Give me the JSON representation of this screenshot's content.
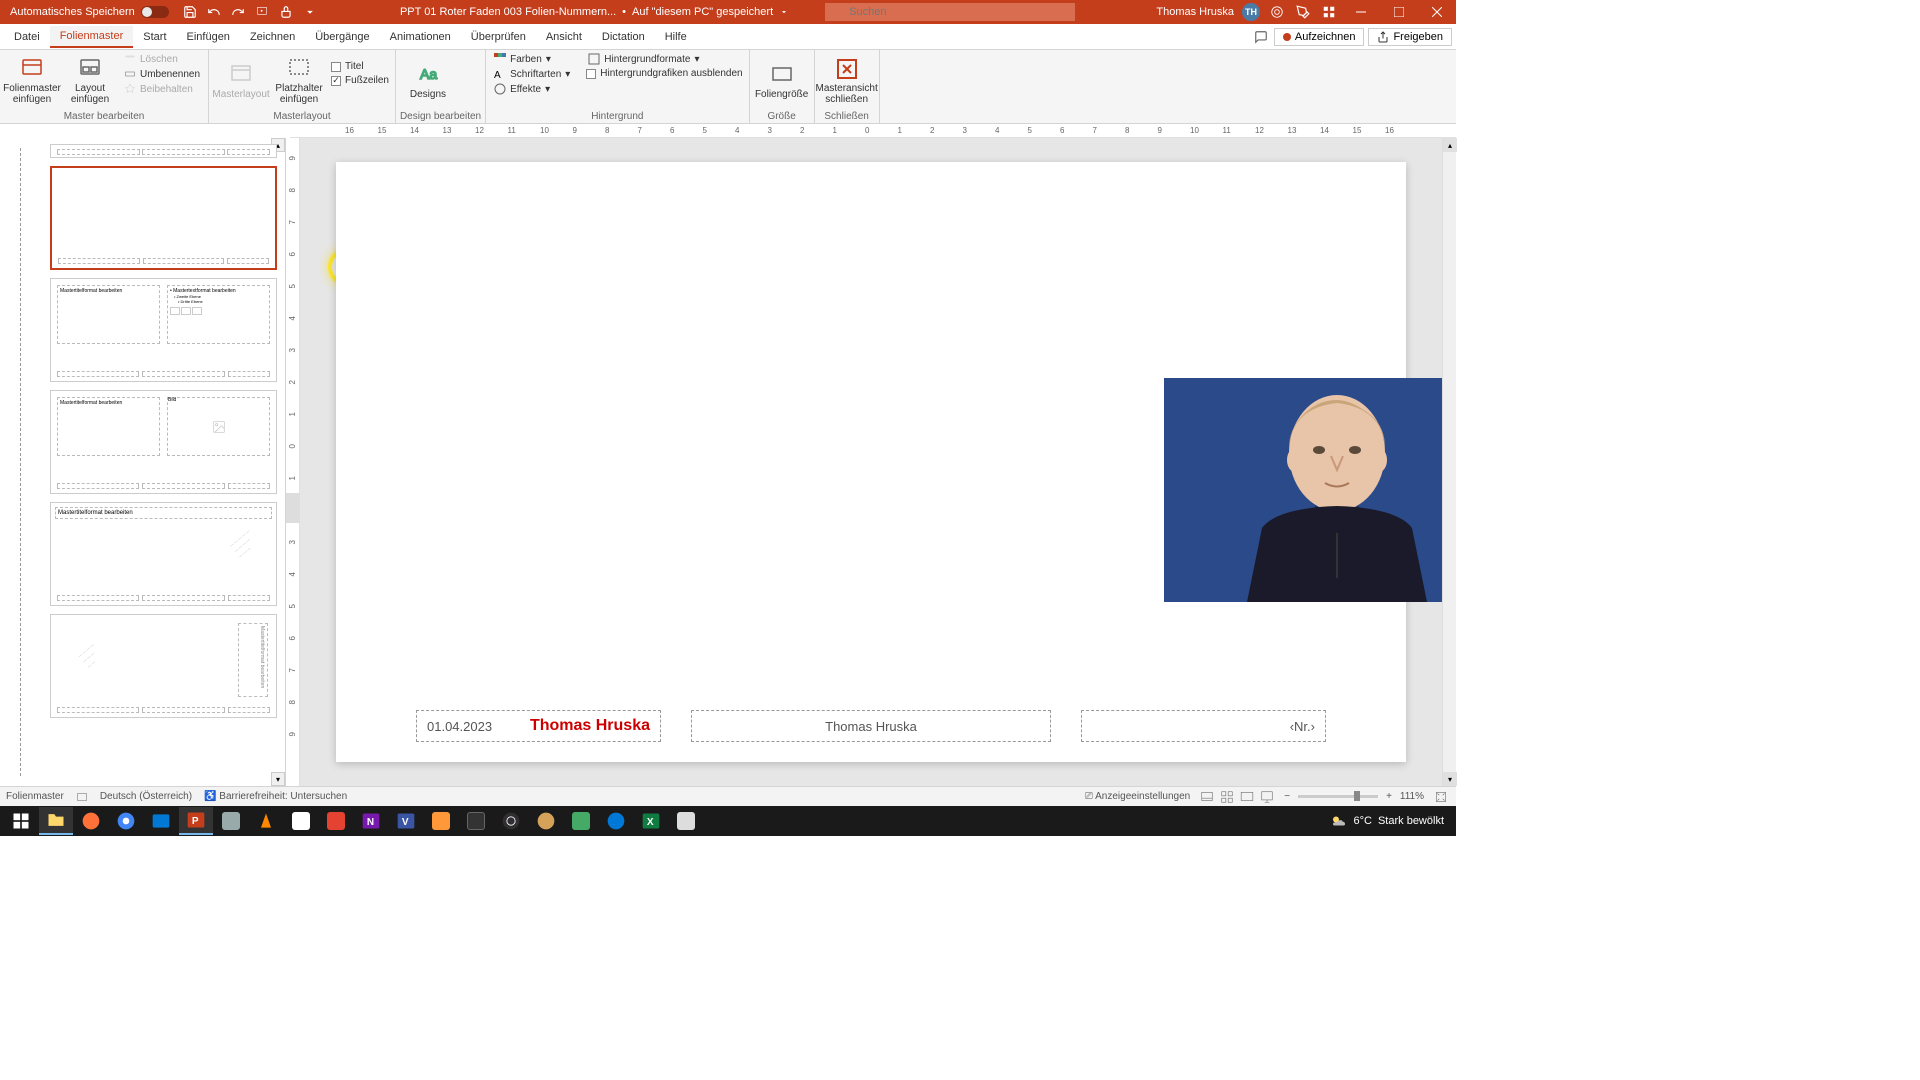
{
  "titlebar": {
    "autosave_label": "Automatisches Speichern",
    "filename": "PPT 01 Roter Faden 003 Folien-Nummern...",
    "save_status": "Auf \"diesem PC\" gespeichert",
    "search_placeholder": "Suchen",
    "user_name": "Thomas Hruska",
    "user_initials": "TH"
  },
  "menu": {
    "items": [
      "Datei",
      "Folienmaster",
      "Start",
      "Einfügen",
      "Zeichnen",
      "Übergänge",
      "Animationen",
      "Überprüfen",
      "Ansicht",
      "Dictation",
      "Hilfe"
    ],
    "record": "Aufzeichnen",
    "share": "Freigeben"
  },
  "ribbon": {
    "group1_label": "Master bearbeiten",
    "insert_master": "Folienmaster einfügen",
    "insert_layout": "Layout einfügen",
    "delete": "Löschen",
    "rename": "Umbenennen",
    "preserve": "Beibehalten",
    "group2_label": "Masterlayout",
    "masterlayout_btn": "Masterlayout",
    "placeholder": "Platzhalter einfügen",
    "title_chk": "Titel",
    "footers_chk": "Fußzeilen",
    "group3_label": "Design bearbeiten",
    "designs": "Designs",
    "group4_label": "Hintergrund",
    "colors": "Farben",
    "fonts": "Schriftarten",
    "effects": "Effekte",
    "bg_formats": "Hintergrundformate",
    "hide_bg": "Hintergrundgrafiken ausblenden",
    "group5_label": "Größe",
    "slide_size": "Foliengröße",
    "group6_label": "Schließen",
    "close_master": "Masteransicht schließen"
  },
  "ruler_h": [
    "16",
    "15",
    "14",
    "13",
    "12",
    "11",
    "10",
    "9",
    "8",
    "7",
    "6",
    "5",
    "4",
    "3",
    "2",
    "1",
    "0",
    "1",
    "2",
    "3",
    "4",
    "5",
    "6",
    "7",
    "8",
    "9",
    "10",
    "11",
    "12",
    "13",
    "14",
    "15",
    "16"
  ],
  "ruler_v": [
    "9",
    "8",
    "7",
    "6",
    "5",
    "4",
    "3",
    "2",
    "1",
    "0",
    "1",
    "2",
    "3",
    "4",
    "5",
    "6",
    "7",
    "8",
    "9"
  ],
  "thumbs": {
    "t2_left": "Mastertitelformat bearbeiten",
    "t2_right_top": "Mastertextformat bearbeiten",
    "t2_right_sub1": "Zweite Ebene",
    "t2_right_sub2": "Dritte Ebene",
    "t3_left": "Mastertitelformat bearbeiten",
    "t3_right": "Bild",
    "t4_title": "Mastertitelformat bearbeiten",
    "t5_right": "Mastertitelformat bearbeiten"
  },
  "slide": {
    "date_placeholder": "01.04.2023",
    "date_highlight": "Thomas Hruska",
    "footer_placeholder": "Thomas Hruska",
    "num_placeholder": "‹Nr.›"
  },
  "statusbar": {
    "view": "Folienmaster",
    "lang": "Deutsch (Österreich)",
    "accessibility": "Barrierefreiheit: Untersuchen",
    "display_settings": "Anzeigeeinstellungen",
    "zoom": "111%"
  },
  "taskbar": {
    "temp": "6°C",
    "weather": "Stark bewölkt"
  }
}
